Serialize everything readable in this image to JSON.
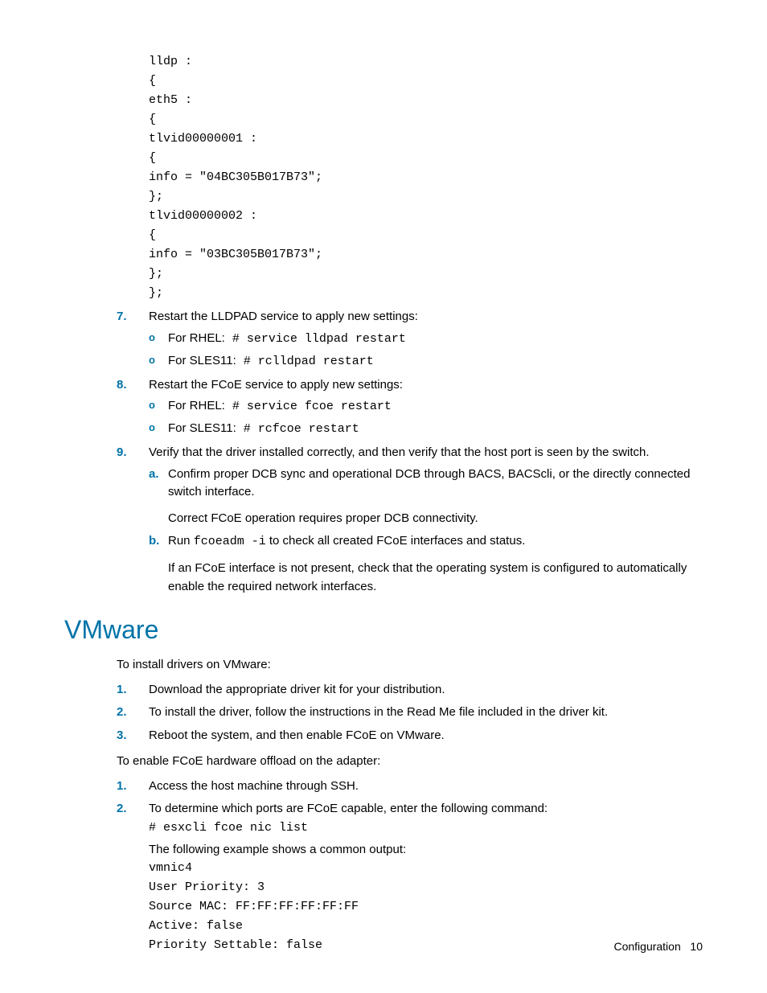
{
  "code_block_top": [
    "lldp :",
    "{",
    "eth5 :",
    "{",
    "tlvid00000001 :",
    "{",
    "info = \"04BC305B017B73\";",
    "};",
    "tlvid00000002 :",
    "{",
    "info = \"03BC305B017B73\";",
    "};",
    "};"
  ],
  "steps_top": {
    "s7": {
      "num": "7.",
      "text": "Restart the LLDPAD service to apply new settings:",
      "sub": [
        {
          "label": "For RHEL:",
          "cmd": " # service lldpad restart"
        },
        {
          "label": "For SLES11:",
          "cmd": " # rclldpad restart"
        }
      ]
    },
    "s8": {
      "num": "8.",
      "text": "Restart the FCoE service to apply new settings:",
      "sub": [
        {
          "label": "For RHEL:",
          "cmd": " # service fcoe restart"
        },
        {
          "label": "For SLES11:",
          "cmd": " # rcfcoe restart"
        }
      ]
    },
    "s9": {
      "num": "9.",
      "text": "Verify that the driver installed correctly, and then verify that the host port is seen by the switch.",
      "a": {
        "marker": "a.",
        "line1": "Confirm proper DCB sync and operational DCB through BACS, BACScli, or the directly connected switch interface.",
        "line2": "Correct FCoE operation requires proper DCB connectivity."
      },
      "b": {
        "marker": "b.",
        "pre": "Run ",
        "cmd": "fcoeadm -i",
        "post": " to check all created FCoE interfaces and status.",
        "line2": "If an FCoE interface is not present, check that the operating system is configured to automatically enable the required network interfaces."
      }
    }
  },
  "vmware": {
    "heading": "VMware",
    "intro1": "To install drivers on VMware:",
    "ol1": {
      "s1": {
        "num": "1.",
        "text": "Download the appropriate driver kit for your distribution."
      },
      "s2": {
        "num": "2.",
        "text": "To install the driver, follow the instructions in the Read Me file included in the driver kit."
      },
      "s3": {
        "num": "3.",
        "text": "Reboot the system, and then enable FCoE on VMware."
      }
    },
    "intro2": "To enable FCoE hardware offload on the adapter:",
    "ol2": {
      "s1": {
        "num": "1.",
        "text": "Access the host machine through SSH."
      },
      "s2": {
        "num": "2.",
        "text": "To determine which ports are FCoE capable, enter the following command:",
        "cmd": "# esxcli fcoe nic list",
        "example_intro": "The following example shows a common output:",
        "output": [
          "vmnic4",
          "User Priority: 3",
          "Source MAC: FF:FF:FF:FF:FF:FF",
          "Active: false",
          "Priority Settable: false"
        ]
      }
    }
  },
  "footer": {
    "section": "Configuration",
    "page": "10"
  }
}
